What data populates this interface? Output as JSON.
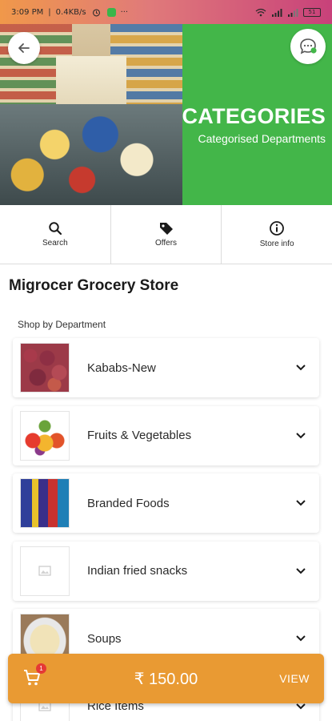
{
  "status_bar": {
    "time": "3:09 PM",
    "network_speed": "0.4KB/s",
    "more": "···",
    "battery": "51"
  },
  "hero": {
    "title": "CATEGORIES",
    "subtitle": "Categorised Departments",
    "accent_color": "#43b649"
  },
  "actions": [
    {
      "label": "Search",
      "icon": "search-icon"
    },
    {
      "label": "Offers",
      "icon": "tag-icon"
    },
    {
      "label": "Store info",
      "icon": "info-icon"
    }
  ],
  "store": {
    "name": "Migrocer Grocery Store",
    "section_label": "Shop by Department"
  },
  "departments": [
    {
      "name": "Kababs-New"
    },
    {
      "name": "Fruits & Vegetables"
    },
    {
      "name": "Branded Foods"
    },
    {
      "name": "Indian fried snacks"
    },
    {
      "name": "Soups"
    },
    {
      "name": "Rice Items"
    }
  ],
  "cart": {
    "count": "1",
    "total": "₹ 150.00",
    "view_label": "VIEW",
    "color": "#e99a33"
  }
}
